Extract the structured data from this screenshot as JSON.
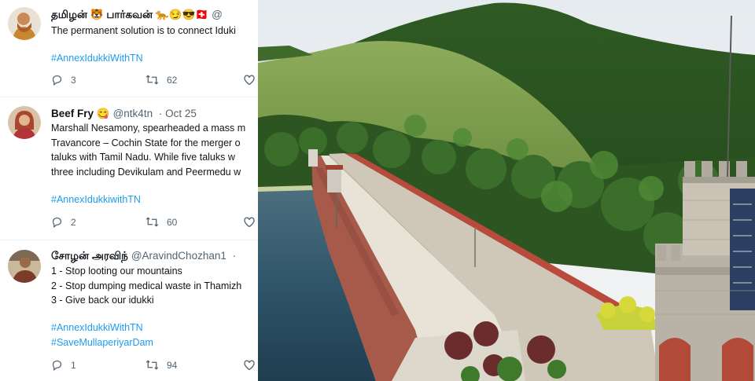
{
  "tweets": [
    {
      "name": "தமிழன் 🐯 பார்கவன் 🐆😏😎🇨🇭",
      "handle": "@",
      "date": "",
      "lines": [
        "The permanent solution is to connect Iduki"
      ],
      "hashtags": [
        "#AnnexIdukkiWithTN"
      ],
      "replies": "3",
      "retweets": "62"
    },
    {
      "name": "Beef Fry 😋",
      "handle": "@ntk4tn",
      "date": "· Oct 25",
      "lines": [
        "Marshall Nesamony, spearheaded a mass m",
        "Travancore – Cochin State for the merger o",
        "taluks with Tamil Nadu. While five taluks w",
        "three including Devikulam and Peermedu w"
      ],
      "hashtags": [
        "#AnnexIdukkiwithTN"
      ],
      "replies": "2",
      "retweets": "60"
    },
    {
      "name": "சோழன் அரவிந்",
      "handle": "@AravindChozhan1",
      "date": "·",
      "lines": [
        "1 - Stop looting our mountains",
        "2 - Stop dumping medical waste in Thamizh",
        "3 - Give back our idukki"
      ],
      "hashtags": [
        "#AnnexIdukkiWithTN",
        "#SaveMullaperiyarDam"
      ],
      "replies": "1",
      "retweets": "94"
    }
  ],
  "icons": {
    "reply": "reply-icon",
    "retweet": "retweet-icon",
    "like": "like-icon"
  },
  "colors": {
    "hashtag": "#1d9bf0",
    "secondary_text": "#536471",
    "divider": "#eff3f4"
  }
}
